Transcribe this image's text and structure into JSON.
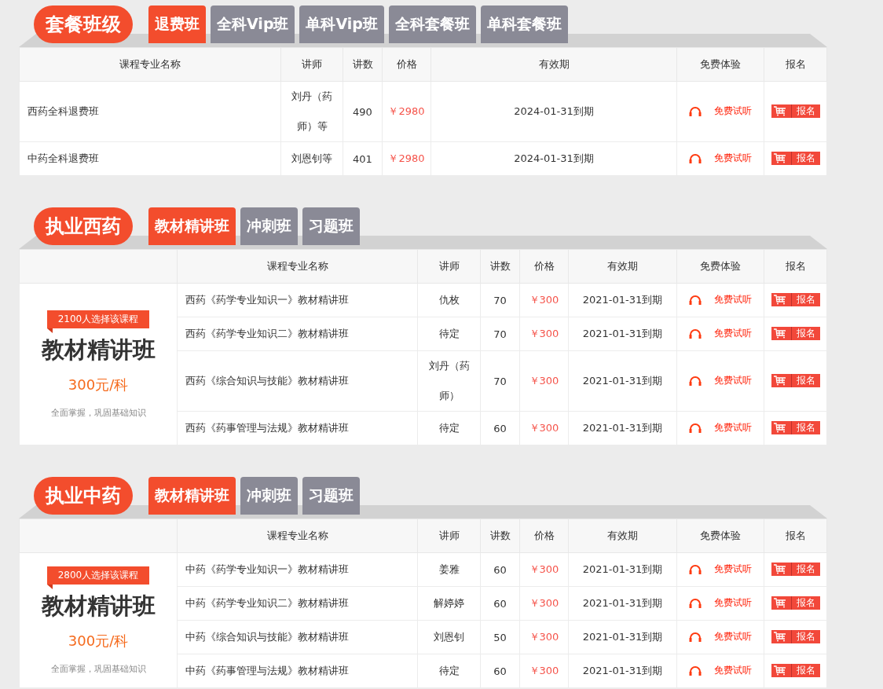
{
  "sections": [
    {
      "title": "套餐班级",
      "tabs": [
        {
          "label": "退费班",
          "selected": true
        },
        {
          "label": "全科Vip班",
          "selected": false
        },
        {
          "label": "单科Vip班",
          "selected": false
        },
        {
          "label": "全科套餐班",
          "selected": false
        },
        {
          "label": "单科套餐班",
          "selected": false
        }
      ],
      "columns": [
        "课程专业名称",
        "讲师",
        "讲数",
        "价格",
        "有效期",
        "免费体验",
        "报名"
      ],
      "rows": [
        {
          "name": "西药全科退费班",
          "teacher": "刘丹（药师）等",
          "count": "490",
          "price": "￥2980",
          "validity": "2024-01-31到期",
          "trial": "免费试听",
          "signup": "报名"
        },
        {
          "name": "中药全科退费班",
          "teacher": "刘恩钊等",
          "count": "401",
          "price": "￥2980",
          "validity": "2024-01-31到期",
          "trial": "免费试听",
          "signup": "报名"
        }
      ]
    },
    {
      "title": "执业西药",
      "tabs": [
        {
          "label": "教材精讲班",
          "selected": true
        },
        {
          "label": "冲刺班",
          "selected": false
        },
        {
          "label": "习题班",
          "selected": false
        }
      ],
      "promo": {
        "badge": "2100人选择该课程",
        "title": "教材精讲班",
        "price": "300元/科",
        "subtitle": "全面掌握，巩固基础知识"
      },
      "columns": [
        "课程专业名称",
        "讲师",
        "讲数",
        "价格",
        "有效期",
        "免费体验",
        "报名"
      ],
      "rows": [
        {
          "name": "西药《药学专业知识一》教材精讲班",
          "teacher": "仇枚",
          "count": "70",
          "price": "￥300",
          "validity": "2021-01-31到期",
          "trial": "免费试听",
          "signup": "报名"
        },
        {
          "name": "西药《药学专业知识二》教材精讲班",
          "teacher": "待定",
          "count": "70",
          "price": "￥300",
          "validity": "2021-01-31到期",
          "trial": "免费试听",
          "signup": "报名"
        },
        {
          "name": "西药《综合知识与技能》教材精讲班",
          "teacher": "刘丹（药师）",
          "count": "70",
          "price": "￥300",
          "validity": "2021-01-31到期",
          "trial": "免费试听",
          "signup": "报名"
        },
        {
          "name": "西药《药事管理与法规》教材精讲班",
          "teacher": "待定",
          "count": "60",
          "price": "￥300",
          "validity": "2021-01-31到期",
          "trial": "免费试听",
          "signup": "报名"
        }
      ]
    },
    {
      "title": "执业中药",
      "tabs": [
        {
          "label": "教材精讲班",
          "selected": true
        },
        {
          "label": "冲刺班",
          "selected": false
        },
        {
          "label": "习题班",
          "selected": false
        }
      ],
      "promo": {
        "badge": "2800人选择该课程",
        "title": "教材精讲班",
        "price": "300元/科",
        "subtitle": "全面掌握，巩固基础知识"
      },
      "columns": [
        "课程专业名称",
        "讲师",
        "讲数",
        "价格",
        "有效期",
        "免费体验",
        "报名"
      ],
      "rows": [
        {
          "name": "中药《药学专业知识一》教材精讲班",
          "teacher": "姜雅",
          "count": "60",
          "price": "￥300",
          "validity": "2021-01-31到期",
          "trial": "免费试听",
          "signup": "报名"
        },
        {
          "name": "中药《药学专业知识二》教材精讲班",
          "teacher": "解婷婷",
          "count": "60",
          "price": "￥300",
          "validity": "2021-01-31到期",
          "trial": "免费试听",
          "signup": "报名"
        },
        {
          "name": "中药《综合知识与技能》教材精讲班",
          "teacher": "刘恩钊",
          "count": "50",
          "price": "￥300",
          "validity": "2021-01-31到期",
          "trial": "免费试听",
          "signup": "报名"
        },
        {
          "name": "中药《药事管理与法规》教材精讲班",
          "teacher": "待定",
          "count": "60",
          "price": "￥300",
          "validity": "2021-01-31到期",
          "trial": "免费试听",
          "signup": "报名"
        }
      ]
    }
  ]
}
